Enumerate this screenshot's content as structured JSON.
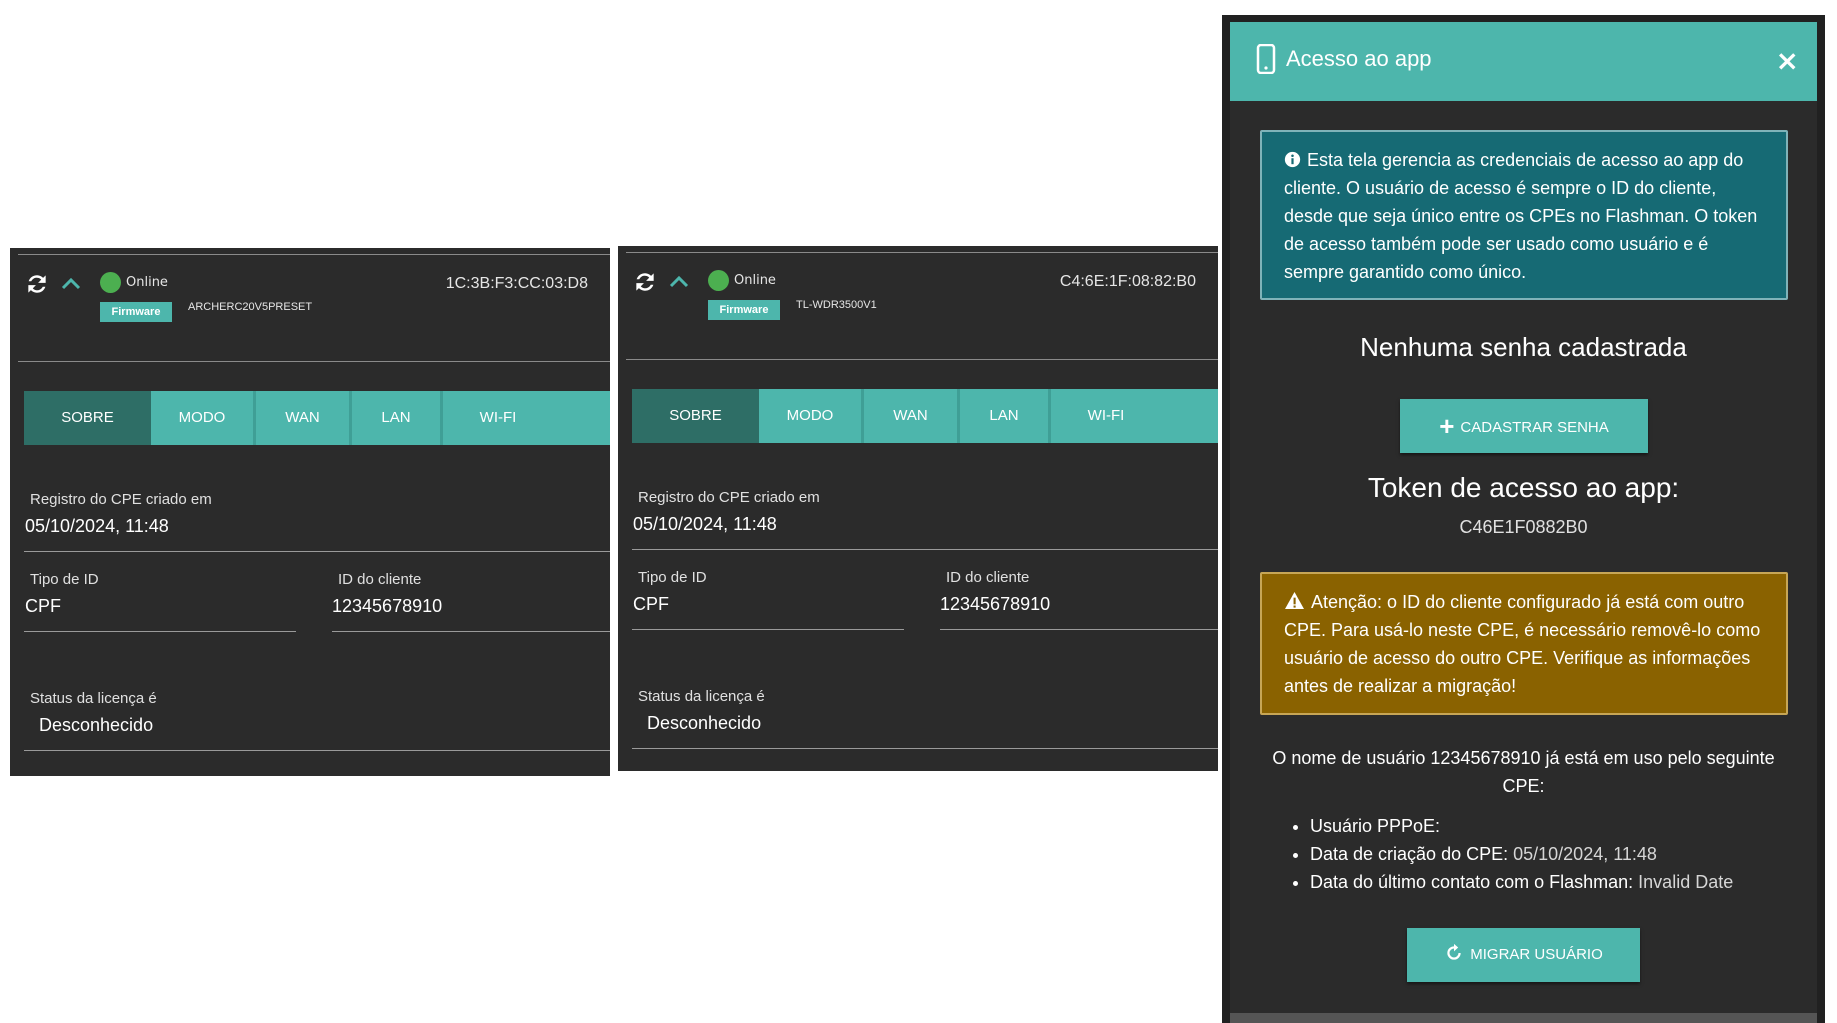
{
  "cpe_cards": [
    {
      "status": "Online",
      "mac": "1C:3B:F3:CC:03:D8",
      "firmware_badge": "Firmware",
      "model": "ARCHERC20V5PRESET",
      "tabs": [
        "SOBRE",
        "MODO",
        "WAN",
        "LAN",
        "WI-FI"
      ],
      "active_tab": "SOBRE",
      "fields": {
        "created_label": "Registro do CPE criado em",
        "created_value": "05/10/2024, 11:48",
        "id_type_label": "Tipo de ID",
        "id_type_value": "CPF",
        "client_id_label": "ID do cliente",
        "client_id_value": "12345678910",
        "license_label": "Status da licença é",
        "license_value": "Desconhecido"
      }
    },
    {
      "status": "Online",
      "mac": "C4:6E:1F:08:82:B0",
      "firmware_badge": "Firmware",
      "model": "TL-WDR3500V1",
      "tabs": [
        "SOBRE",
        "MODO",
        "WAN",
        "LAN",
        "WI-FI"
      ],
      "active_tab": "SOBRE",
      "fields": {
        "created_label": "Registro do CPE criado em",
        "created_value": "05/10/2024, 11:48",
        "id_type_label": "Tipo de ID",
        "id_type_value": "CPF",
        "client_id_label": "ID do cliente",
        "client_id_value": "12345678910",
        "license_label": "Status da licença é",
        "license_value": "Desconhecido"
      }
    }
  ],
  "modal": {
    "title": "Acesso ao app",
    "close": "×",
    "info_text": "Esta tela gerencia as credenciais de acesso ao app do cliente. O usuário de acesso é sempre o ID do cliente, desde que seja único entre os CPEs no Flashman. O token de acesso também pode ser usado como usuário e é sempre garantido como único.",
    "no_password": "Nenhuma senha cadastrada",
    "register_button": "CADASTRAR SENHA",
    "token_title": "Token de acesso ao app:",
    "token_value": "C46E1F0882B0",
    "warning_text": "Atenção: o ID do cliente configurado já está com outro CPE. Para usá-lo neste CPE, é necessário removê-lo como usuário de acesso do outro CPE. Verifique as informações antes de realizar a migração!",
    "in_use_text": "O nome de usuário 12345678910 já está em uso pelo seguinte CPE:",
    "details": [
      {
        "label": "Usuário PPPoE:",
        "value": ""
      },
      {
        "label": "Data de criação do CPE:",
        "value": "05/10/2024, 11:48"
      },
      {
        "label": "Data do último contato com o Flashman:",
        "value": "Invalid Date"
      }
    ],
    "migrate_button": "MIGRAR USUÁRIO"
  },
  "colors": {
    "accent": "#4db6ac",
    "tab_active": "#2e6e66",
    "panel_bg": "#2b2b2b",
    "info_bg": "#166a74",
    "warn_bg": "#8a6200",
    "online": "#4caf50"
  }
}
